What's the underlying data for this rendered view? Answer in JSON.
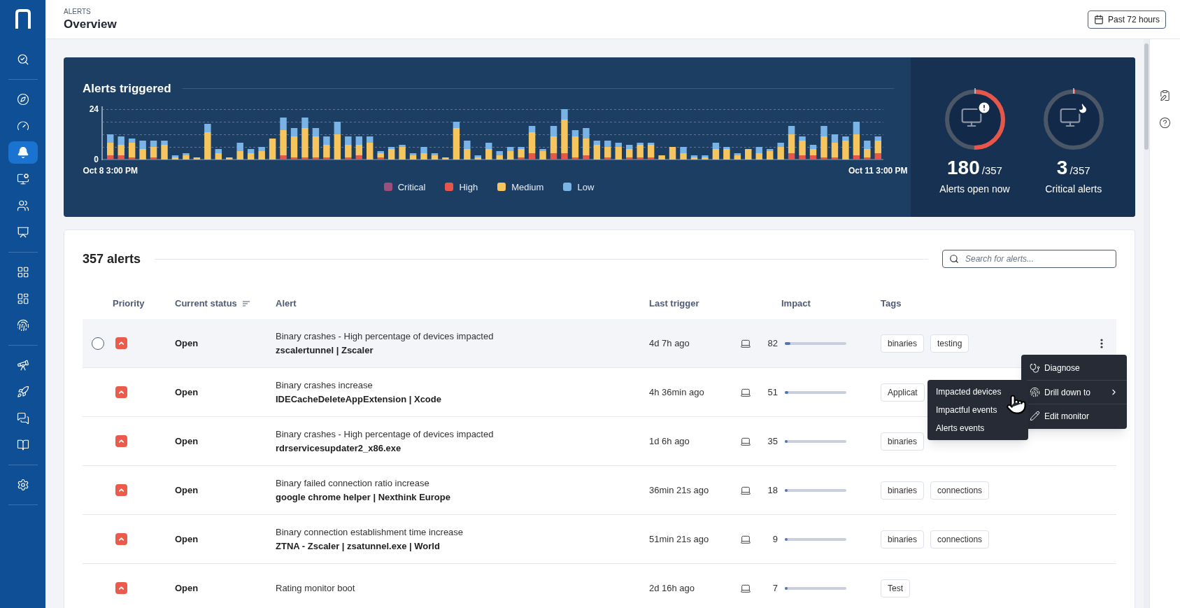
{
  "sidebar": {
    "groups": [
      {
        "items": [
          {
            "selected": false
          }
        ]
      },
      {
        "items": [
          {
            "selected": false
          },
          {
            "selected": false
          },
          {
            "selected": true
          },
          {
            "selected": false
          },
          {
            "selected": false
          },
          {
            "selected": false
          }
        ]
      },
      {
        "items": [
          {
            "selected": false
          },
          {
            "selected": false
          },
          {
            "selected": false
          }
        ]
      },
      {
        "items": [
          {
            "selected": false
          },
          {
            "selected": false
          },
          {
            "selected": false
          },
          {
            "selected": false
          }
        ]
      },
      {
        "items": [
          {
            "selected": false
          }
        ]
      }
    ]
  },
  "header": {
    "section": "ALERTS",
    "title": "Overview",
    "range_button": "Past 72 hours"
  },
  "summary": {
    "title": "Alerts triggered",
    "chart_data": {
      "type": "bar",
      "stacked": true,
      "legend": "bottom",
      "ylim": [
        0,
        24
      ],
      "yticks": [
        0,
        24
      ],
      "categories": [
        "Oct 8 3:00 PM",
        null,
        null,
        null,
        null,
        null,
        null,
        null,
        null,
        null,
        null,
        null,
        null,
        null,
        null,
        null,
        null,
        null,
        null,
        null,
        null,
        null,
        null,
        null,
        null,
        null,
        null,
        null,
        null,
        null,
        null,
        null,
        null,
        null,
        null,
        null,
        null,
        null,
        null,
        null,
        null,
        null,
        null,
        null,
        null,
        null,
        null,
        null,
        null,
        null,
        null,
        null,
        null,
        null,
        null,
        null,
        null,
        null,
        null,
        null,
        null,
        null,
        null,
        null,
        null,
        null,
        null,
        null,
        null,
        null,
        null,
        "Oct 11 3:00 PM"
      ],
      "series": [
        {
          "name": "Critical",
          "color": "#9c4f7c",
          "values": [
            0,
            0,
            0,
            0,
            0,
            0,
            0,
            0,
            0,
            0,
            0,
            0,
            0,
            0,
            0,
            0,
            0,
            0,
            0,
            0,
            0,
            0,
            0,
            0,
            0,
            0,
            0,
            0,
            0,
            0,
            0,
            0,
            0,
            0,
            0,
            0,
            0,
            0,
            0,
            0,
            0,
            0,
            0,
            0,
            0,
            0,
            0,
            0,
            0,
            0,
            0,
            0,
            0,
            0,
            0,
            0,
            0,
            0,
            0,
            0,
            0,
            0,
            0,
            0,
            0,
            0,
            0,
            0,
            0,
            0,
            0,
            0
          ]
        },
        {
          "name": "High",
          "color": "#e8564a",
          "values": [
            2,
            2,
            1,
            0,
            1,
            0,
            0,
            0,
            0,
            0,
            0,
            0,
            0,
            0,
            0,
            0,
            2,
            1,
            1,
            1,
            1,
            0,
            1,
            2,
            0,
            1,
            0,
            0,
            0,
            0,
            0,
            0,
            0,
            0,
            0,
            0,
            0,
            0,
            1,
            3,
            0,
            3,
            3,
            1,
            2,
            0,
            1,
            0,
            1,
            1,
            1,
            0,
            0,
            0,
            0,
            0,
            0,
            0,
            0,
            0,
            0,
            0,
            0,
            3,
            2,
            2,
            1,
            1,
            0,
            2,
            1,
            3
          ]
        },
        {
          "name": "Medium",
          "color": "#f7c55d",
          "values": [
            6,
            5,
            7,
            5,
            5,
            7,
            1,
            2,
            1,
            13,
            3,
            1,
            4,
            3,
            4,
            10,
            12,
            10,
            14,
            10,
            6,
            12,
            6,
            5,
            8,
            2,
            5,
            6,
            2,
            3,
            2,
            1,
            15,
            5,
            1,
            5,
            2,
            4,
            4,
            10,
            4,
            8,
            16,
            10,
            8,
            7,
            5,
            6,
            4,
            6,
            6,
            2,
            6,
            3,
            1,
            1,
            5,
            5,
            2,
            5,
            3,
            4,
            6,
            9,
            7,
            3,
            10,
            7,
            9,
            10,
            4,
            6
          ]
        },
        {
          "name": "Low",
          "color": "#7ab3e6",
          "values": [
            4,
            4,
            2,
            4,
            3,
            2,
            1,
            1,
            0,
            4,
            2,
            0,
            4,
            2,
            2,
            0,
            6,
            4,
            5,
            4,
            4,
            6,
            4,
            4,
            3,
            1,
            1,
            1,
            1,
            3,
            1,
            0,
            3,
            4,
            1,
            3,
            2,
            2,
            1,
            3,
            1,
            5,
            5,
            3,
            5,
            2,
            3,
            2,
            2,
            1,
            1,
            0,
            0,
            3,
            1,
            1,
            3,
            1,
            1,
            0,
            3,
            1,
            2,
            4,
            2,
            2,
            5,
            4,
            2,
            6,
            4,
            2
          ]
        }
      ]
    },
    "stats": [
      {
        "kind": "open",
        "value": "180",
        "total": "/357",
        "label": "Alerts open now",
        "level": 0.504
      },
      {
        "kind": "critical",
        "value": "3",
        "total": "/357",
        "label": "Critical alerts",
        "level": 0.008
      }
    ]
  },
  "alerts": {
    "count": "357 alerts",
    "search": {
      "placeholder": "Search for alerts..."
    },
    "columns": [
      "Priority",
      "Current status",
      "Alert",
      "Last trigger",
      "Impact",
      "Tags"
    ],
    "rows": [
      {
        "highlighted": true,
        "priority": {
          "kind": "high"
        },
        "status": "Open",
        "title": "Binary crashes - High percentage of devices impacted",
        "subtitle": "zscalertunnel | Zscaler",
        "last_trigger": "4d 7h ago",
        "impact": "82",
        "level": 0.09,
        "tags": [
          "binaries",
          "testing"
        ]
      },
      {
        "highlighted": false,
        "priority": {
          "kind": "high"
        },
        "status": "Open",
        "title": "Binary crashes increase",
        "subtitle": "IDECacheDeleteAppExtension | Xcode",
        "last_trigger": "4h 36min ago",
        "impact": "51",
        "level": 0.06,
        "tags": [
          "Applicat"
        ]
      },
      {
        "highlighted": false,
        "priority": {
          "kind": "high"
        },
        "status": "Open",
        "title": "Binary crashes - High percentage of devices impacted",
        "subtitle": "rdrservicesupdater2_x86.exe",
        "last_trigger": "1d 6h ago",
        "impact": "35",
        "level": 0.04,
        "tags": [
          "binaries"
        ]
      },
      {
        "highlighted": false,
        "priority": {
          "kind": "high"
        },
        "status": "Open",
        "title": "Binary failed connection ratio increase",
        "subtitle": "google chrome helper | Nexthink Europe",
        "last_trigger": "36min 21s ago",
        "impact": "18",
        "level": 0.03,
        "tags": [
          "binaries",
          "connections"
        ]
      },
      {
        "highlighted": false,
        "priority": {
          "kind": "high"
        },
        "status": "Open",
        "title": "Binary connection establishment time increase",
        "subtitle": "ZTNA - Zscaler | zsatunnel.exe | World",
        "last_trigger": "51min 21s ago",
        "impact": "9",
        "level": 0.03,
        "tags": [
          "binaries",
          "connections"
        ]
      },
      {
        "highlighted": false,
        "priority": {
          "kind": "high"
        },
        "status": "Open",
        "title": "Rating monitor boot",
        "last_trigger": "2d 16h ago",
        "impact": "7",
        "level": 0.03,
        "tags": [
          "Test"
        ]
      }
    ]
  },
  "context_menu": {
    "items": [
      {
        "kind": "diagnose",
        "label": "Diagnose"
      },
      {
        "kind": "submenu",
        "label": "Drill down to"
      },
      {
        "kind": "edit",
        "label": "Edit monitor"
      }
    ],
    "submenu": [
      "Impacted devices",
      "Impactful events",
      "Alerts events"
    ]
  }
}
